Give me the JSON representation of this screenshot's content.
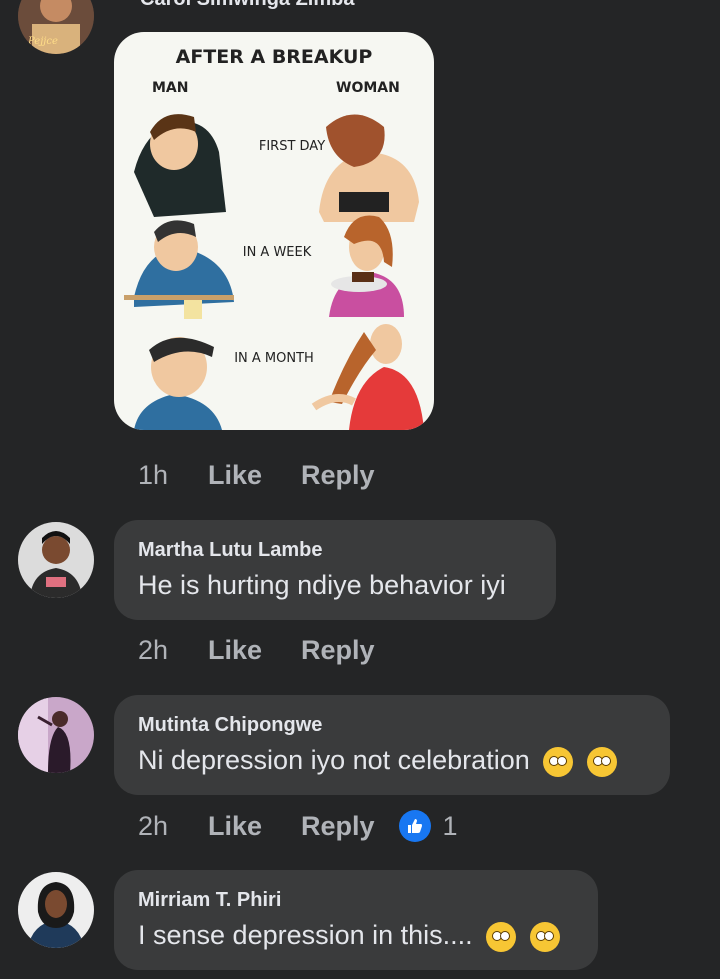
{
  "comments": [
    {
      "author": "Carol Simwinga Zimba",
      "time": "1h",
      "like_label": "Like",
      "reply_label": "Reply",
      "image": {
        "title": "AFTER A BREAKUP",
        "left_header": "MAN",
        "right_header": "WOMAN",
        "rows": [
          "FIRST DAY",
          "IN A WEEK",
          "IN A MONTH"
        ]
      }
    },
    {
      "author": "Martha Lutu Lambe",
      "text": "He is hurting ndiye behavior iyi",
      "time": "2h",
      "like_label": "Like",
      "reply_label": "Reply"
    },
    {
      "author": "Mutinta Chipongwe",
      "text": "Ni depression iyo not celebration",
      "emojis": [
        "eye-roll-emoji",
        "eye-roll-emoji"
      ],
      "time": "2h",
      "like_label": "Like",
      "reply_label": "Reply",
      "reaction": {
        "icon": "thumbs-up-icon",
        "count": "1",
        "color": "#1877f2"
      }
    },
    {
      "author": "Mirriam T. Phiri",
      "text": "I sense depression in this....",
      "emojis": [
        "thinking-emoji",
        "eye-roll-emoji"
      ]
    }
  ],
  "colors": {
    "background": "#242526",
    "bubble": "#3a3b3c",
    "text_primary": "#e4e6eb",
    "text_secondary": "#b0b3b8",
    "accent": "#1877f2"
  }
}
